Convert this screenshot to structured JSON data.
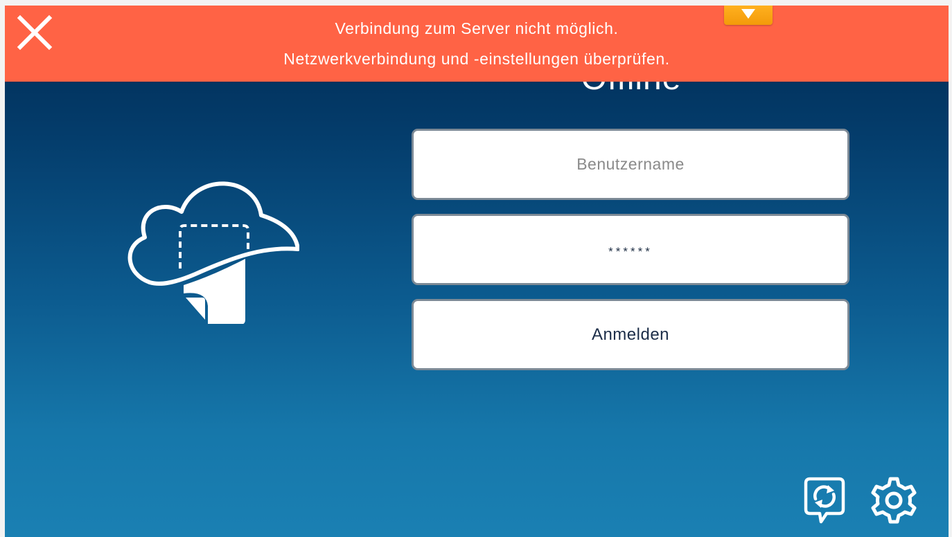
{
  "login": {
    "title": "Offline",
    "username_placeholder": "Benutzername",
    "username_value": "",
    "password_mask": "******",
    "login_button_label": "Anmelden"
  },
  "alert": {
    "line1": "Verbindung zum Server nicht möglich.",
    "line2": "Netzwerkverbindung und -einstellungen überprüfen.",
    "close_icon": "close-icon",
    "collapse_icon": "chevron-down-icon"
  },
  "footer": {
    "sync_icon": "sync-icon",
    "settings_icon": "gear-icon"
  },
  "colors": {
    "alert_background": "#ff6345",
    "collapse_tab": "#ffb11f",
    "background_top": "#002a52",
    "background_bottom": "#1a80b3",
    "field_border": "#7d8a96"
  }
}
